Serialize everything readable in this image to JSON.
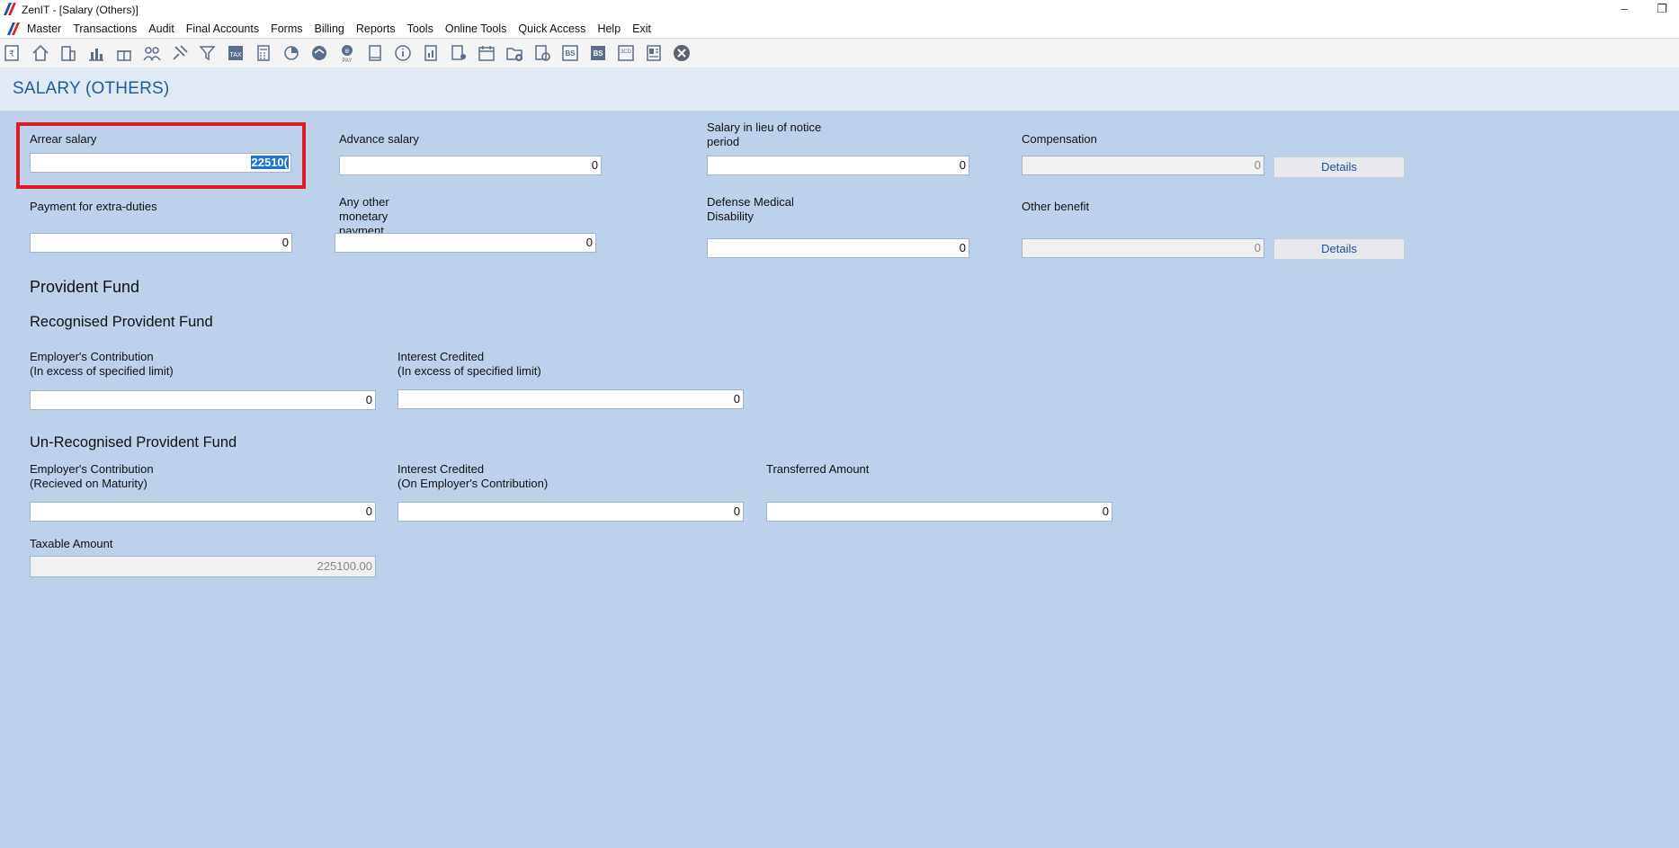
{
  "window": {
    "title": "ZenIT - [Salary (Others)]",
    "minimize": "–",
    "restore": "❐"
  },
  "menu": [
    "Master",
    "Transactions",
    "Audit",
    "Final Accounts",
    "Forms",
    "Billing",
    "Reports",
    "Tools",
    "Online Tools",
    "Quick Access",
    "Help",
    "Exit"
  ],
  "toolbar_icons": [
    "ledger-icon",
    "home-icon",
    "building-icon",
    "bar-chart-icon",
    "gift-icon",
    "users-icon",
    "pin-icon",
    "filter-icon",
    "tax-icon",
    "calculator-icon",
    "pie-chart-icon",
    "speedometer-icon",
    "e-pay-icon",
    "book-icon",
    "info-icon",
    "report-icon",
    "document-user-icon",
    "calendar-icon",
    "folder-add-icon",
    "refresh-doc-icon",
    "bs-icon",
    "bs-alt-icon",
    "3cd-icon",
    "form-icon",
    "close-icon"
  ],
  "page": {
    "title": "SALARY (OTHERS)"
  },
  "fields": {
    "arrear_salary": {
      "label": "Arrear salary",
      "value": "22510("
    },
    "advance_salary": {
      "label": "Advance salary",
      "value": "0"
    },
    "salary_in_lieu": {
      "label_line1": "Salary in lieu of  notice",
      "label_line2": "period",
      "value": "0"
    },
    "compensation": {
      "label": "Compensation",
      "value": "0",
      "details": "Details"
    },
    "extra_duties": {
      "label": "Payment for extra-duties",
      "value": "0"
    },
    "other_monetary": {
      "label_line1": "Any other",
      "label_line2": "monetary",
      "label_line3": "payment",
      "value": "0"
    },
    "defense_medical": {
      "label_line1": "Defense Medical",
      "label_line2": "Disability",
      "value": "0"
    },
    "other_benefit": {
      "label": "Other benefit",
      "value": "0",
      "details": "Details"
    }
  },
  "provident_fund": {
    "heading": "Provident Fund",
    "recognised": {
      "heading": "Recognised Provident Fund",
      "employer_contribution": {
        "label_line1": "Employer's Contribution",
        "label_line2": "(In excess of specified limit)",
        "value": "0"
      },
      "interest_credited": {
        "label_line1": "Interest Credited",
        "label_line2": "(In excess of specified limit)",
        "value": "0"
      }
    },
    "unrecognised": {
      "heading": "Un-Recognised Provident Fund",
      "employer_contribution": {
        "label_line1": "Employer's Contribution",
        "label_line2": "(Recieved on Maturity)",
        "value": "0"
      },
      "interest_credited": {
        "label_line1": "Interest Credited",
        "label_line2": "(On Employer's Contribution)",
        "value": "0"
      },
      "transferred_amount": {
        "label": "Transferred Amount",
        "value": "0"
      }
    }
  },
  "taxable": {
    "label": "Taxable Amount",
    "value": "225100.00"
  },
  "colors": {
    "background": "#bdd1ea",
    "title": "#1f5b9e",
    "highlight": "#dc1c25",
    "selection": "#1a73d6"
  }
}
